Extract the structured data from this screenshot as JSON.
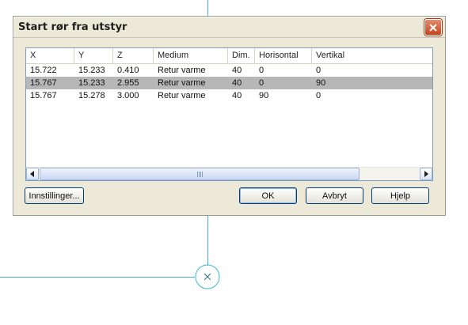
{
  "dialog": {
    "title": "Start rør fra utstyr"
  },
  "table": {
    "columns": [
      "X",
      "Y",
      "Z",
      "Medium",
      "Dim.",
      "Horisontal",
      "Vertikal"
    ],
    "rows": [
      [
        "15.722",
        "15.233",
        "0.410",
        "Retur varme",
        "40",
        "0",
        "0"
      ],
      [
        "15.767",
        "15.233",
        "2.955",
        "Retur varme",
        "40",
        "0",
        "90"
      ],
      [
        "15.767",
        "15.278",
        "3.000",
        "Retur varme",
        "40",
        "90",
        "0"
      ]
    ],
    "selected_row_index": 1
  },
  "buttons": {
    "settings": "Innstillinger...",
    "ok": "OK",
    "cancel": "Avbryt",
    "help": "Hjelp"
  },
  "colors": {
    "cad_line": "#3cb7c9",
    "dialog_bg": "#ece9d8",
    "selected_row": "#b7b7b7"
  }
}
